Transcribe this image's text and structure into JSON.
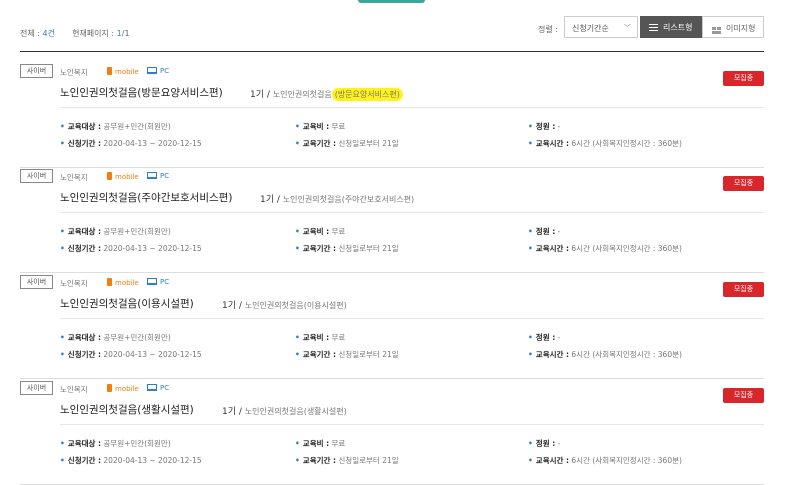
{
  "summary": {
    "total_label": "전체 :",
    "total": "4건",
    "page_label": "현재페이지 :",
    "page_current": "1",
    "page_total": "/1"
  },
  "sort": {
    "label": "정렬 :",
    "value": "신청기간순"
  },
  "view": {
    "list": "리스트형",
    "image": "이미지형"
  },
  "courses": [
    {
      "type": "사이버",
      "category": "노인복지",
      "mobile": "mobile",
      "pc": "PC",
      "title": "노인인권의첫걸음(방문요양서비스편)",
      "round": "1기",
      "round_sep": "/",
      "sub_prefix": "노인인권의첫걸음",
      "sub_highlight": "(방문요양서비스편)",
      "sub_suffix": "",
      "status": "모집중",
      "target_label": "교육대상 :",
      "target": "공무원+민간(회원만)",
      "fee_label": "교육비 :",
      "fee": "무료",
      "capacity_label": "정원 :",
      "capacity": "-",
      "apply_label": "신청기간 :",
      "apply": "2020-04-13 ~ 2020-12-15",
      "period_label": "교육기간 :",
      "period": "신청일로부터 21일",
      "hours_label": "교육시간 :",
      "hours": "6시간 (사회복지인정시간 : 360분)"
    },
    {
      "type": "사이버",
      "category": "노인복지",
      "mobile": "mobile",
      "pc": "PC",
      "title": "노인인권의첫걸음(주야간보호서비스편)",
      "round": "1기",
      "round_sep": "/",
      "sub_prefix": "노인인권의첫걸음(주야간보호서비스편)",
      "sub_highlight": "",
      "sub_suffix": "",
      "status": "모집중",
      "target_label": "교육대상 :",
      "target": "공무원+민간(회원만)",
      "fee_label": "교육비 :",
      "fee": "무료",
      "capacity_label": "정원 :",
      "capacity": "-",
      "apply_label": "신청기간 :",
      "apply": "2020-04-13 ~ 2020-12-15",
      "period_label": "교육기간 :",
      "period": "신청일로부터 21일",
      "hours_label": "교육시간 :",
      "hours": "6시간 (사회복지인정시간 : 360분)"
    },
    {
      "type": "사이버",
      "category": "노인복지",
      "mobile": "mobile",
      "pc": "PC",
      "title": "노인인권의첫걸음(이용시설편)",
      "round": "1기",
      "round_sep": "/",
      "sub_prefix": "노인인권의첫걸음(이용시설편)",
      "sub_highlight": "",
      "sub_suffix": "",
      "status": "모집중",
      "target_label": "교육대상 :",
      "target": "공무원+민간(회원만)",
      "fee_label": "교육비 :",
      "fee": "무료",
      "capacity_label": "정원 :",
      "capacity": "-",
      "apply_label": "신청기간 :",
      "apply": "2020-04-13 ~ 2020-12-15",
      "period_label": "교육기간 :",
      "period": "신청일로부터 21일",
      "hours_label": "교육시간 :",
      "hours": "6시간 (사회복지인정시간 : 360분)"
    },
    {
      "type": "사이버",
      "category": "노인복지",
      "mobile": "mobile",
      "pc": "PC",
      "title": "노인인권의첫걸음(생활시설편)",
      "round": "1기",
      "round_sep": "/",
      "sub_prefix": "노인인권의첫걸음(생활시설편)",
      "sub_highlight": "",
      "sub_suffix": "",
      "status": "모집중",
      "target_label": "교육대상 :",
      "target": "공무원+민간(회원만)",
      "fee_label": "교육비 :",
      "fee": "무료",
      "capacity_label": "정원 :",
      "capacity": "-",
      "apply_label": "신청기간 :",
      "apply": "2020-04-13 ~ 2020-12-15",
      "period_label": "교육기간 :",
      "period": "신청일로부터 21일",
      "hours_label": "교육시간 :",
      "hours": "6시간 (사회복지인정시간 : 360분)"
    }
  ]
}
